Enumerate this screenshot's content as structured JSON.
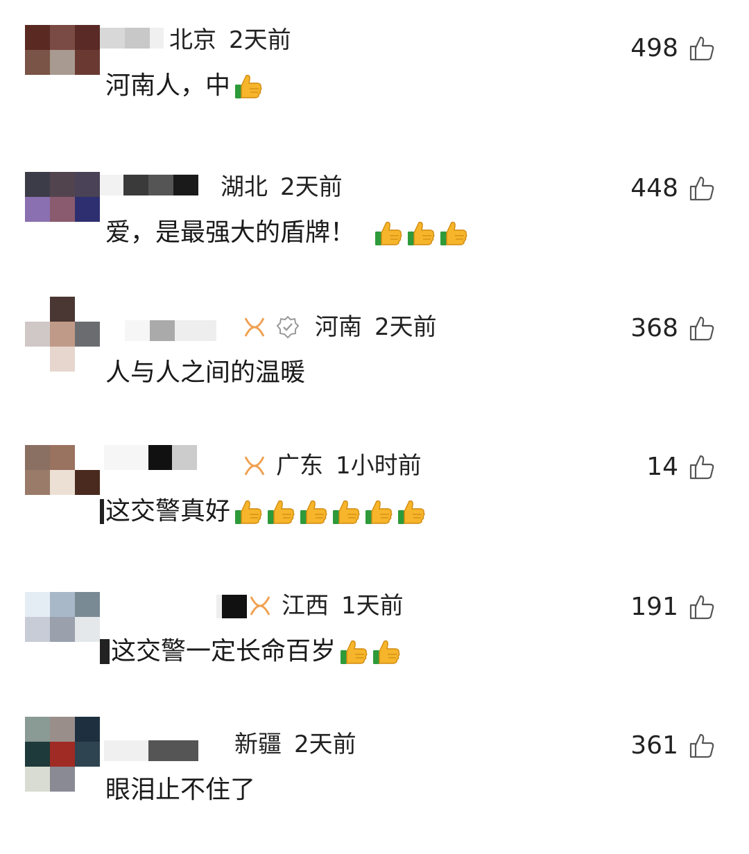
{
  "comments": [
    {
      "region": "北京",
      "time": "2天前",
      "content": "河南人，中",
      "thumbs_count": 1,
      "likes": "498",
      "avatar_colors": [
        "#5a2a22",
        "#7a4a44",
        "#5a2a26",
        "#7a5446",
        "#a89a90",
        "#6a3a32"
      ],
      "name_colors": [
        "#d8d8d8",
        "#c8c8c8",
        "#f0f0f0"
      ],
      "has_vip": false,
      "has_verify": false
    },
    {
      "region": "湖北",
      "time": "2天前",
      "content": "爱，是最强大的盾牌！",
      "thumbs_count": 3,
      "likes": "448",
      "avatar_colors": [
        "#3c3c48",
        "#52444e",
        "#4a4256",
        "#8a70b0",
        "#8a5a6e",
        "#2e2f70"
      ],
      "name_colors": [
        "#f2f2f2",
        "#3a3a3a",
        "#555555",
        "#1a1a1a"
      ],
      "has_vip": false,
      "has_verify": false
    },
    {
      "region": "河南",
      "time": "2天前",
      "content": "人与人之间的温暖",
      "thumbs_count": 0,
      "likes": "368",
      "avatar_colors": [
        "#ffffff",
        "#4a3632",
        "#ffffff",
        "#cfc8c6",
        "#c09a88",
        "#6a6c70"
      ],
      "avatar_extra": "#e6d6ce",
      "name_colors": [
        "#f6f6f6",
        "#aaaaaa",
        "#eeeeee"
      ],
      "has_vip": true,
      "has_verify": true
    },
    {
      "region": "广东",
      "time": "1小时前",
      "content": "这交警真好",
      "thumbs_count": 6,
      "likes": "14",
      "avatar_colors": [
        "#8a7062",
        "#9a7260",
        "#ffffff",
        "#9a7a68",
        "#ece0d4",
        "#4a2a1e"
      ],
      "name_colors": [
        "#f6f6f6",
        "#111111",
        "#cccccc"
      ],
      "has_vip": true,
      "has_verify": false
    },
    {
      "region": "江西",
      "time": "1天前",
      "content": "这交警一定长命百岁",
      "thumbs_count": 2,
      "likes": "191",
      "avatar_colors": [
        "#e4ecf4",
        "#a8b8c8",
        "#7a8a94",
        "#c8ccd6",
        "#9aa0ac",
        "#e4e8ea"
      ],
      "name_colors": [
        "#eeeeee",
        "#111111"
      ],
      "has_vip": true,
      "has_verify": false
    },
    {
      "region": "新疆",
      "time": "2天前",
      "content": "眼泪止不住了",
      "thumbs_count": 0,
      "likes": "361",
      "avatar_colors": [
        "#8a9a94",
        "#9a8e8a",
        "#1e3040",
        "#1e3a3a",
        "#a02a24",
        "#2e4450"
      ],
      "avatar_extra": "#d8dcd2",
      "name_colors": [
        "#f0f0f0",
        "#555555"
      ],
      "has_vip": false,
      "has_verify": false
    }
  ],
  "icons": {
    "like": "thumbs-up-outline-icon",
    "vip": "vip-ribbon-icon",
    "verify": "verified-badge-icon",
    "thumb_emoji": "thumbs-up-emoji-icon"
  },
  "colors": {
    "text": "#1a1a1a",
    "vip_orange": "#f0a050",
    "icon_gray": "#555555"
  }
}
